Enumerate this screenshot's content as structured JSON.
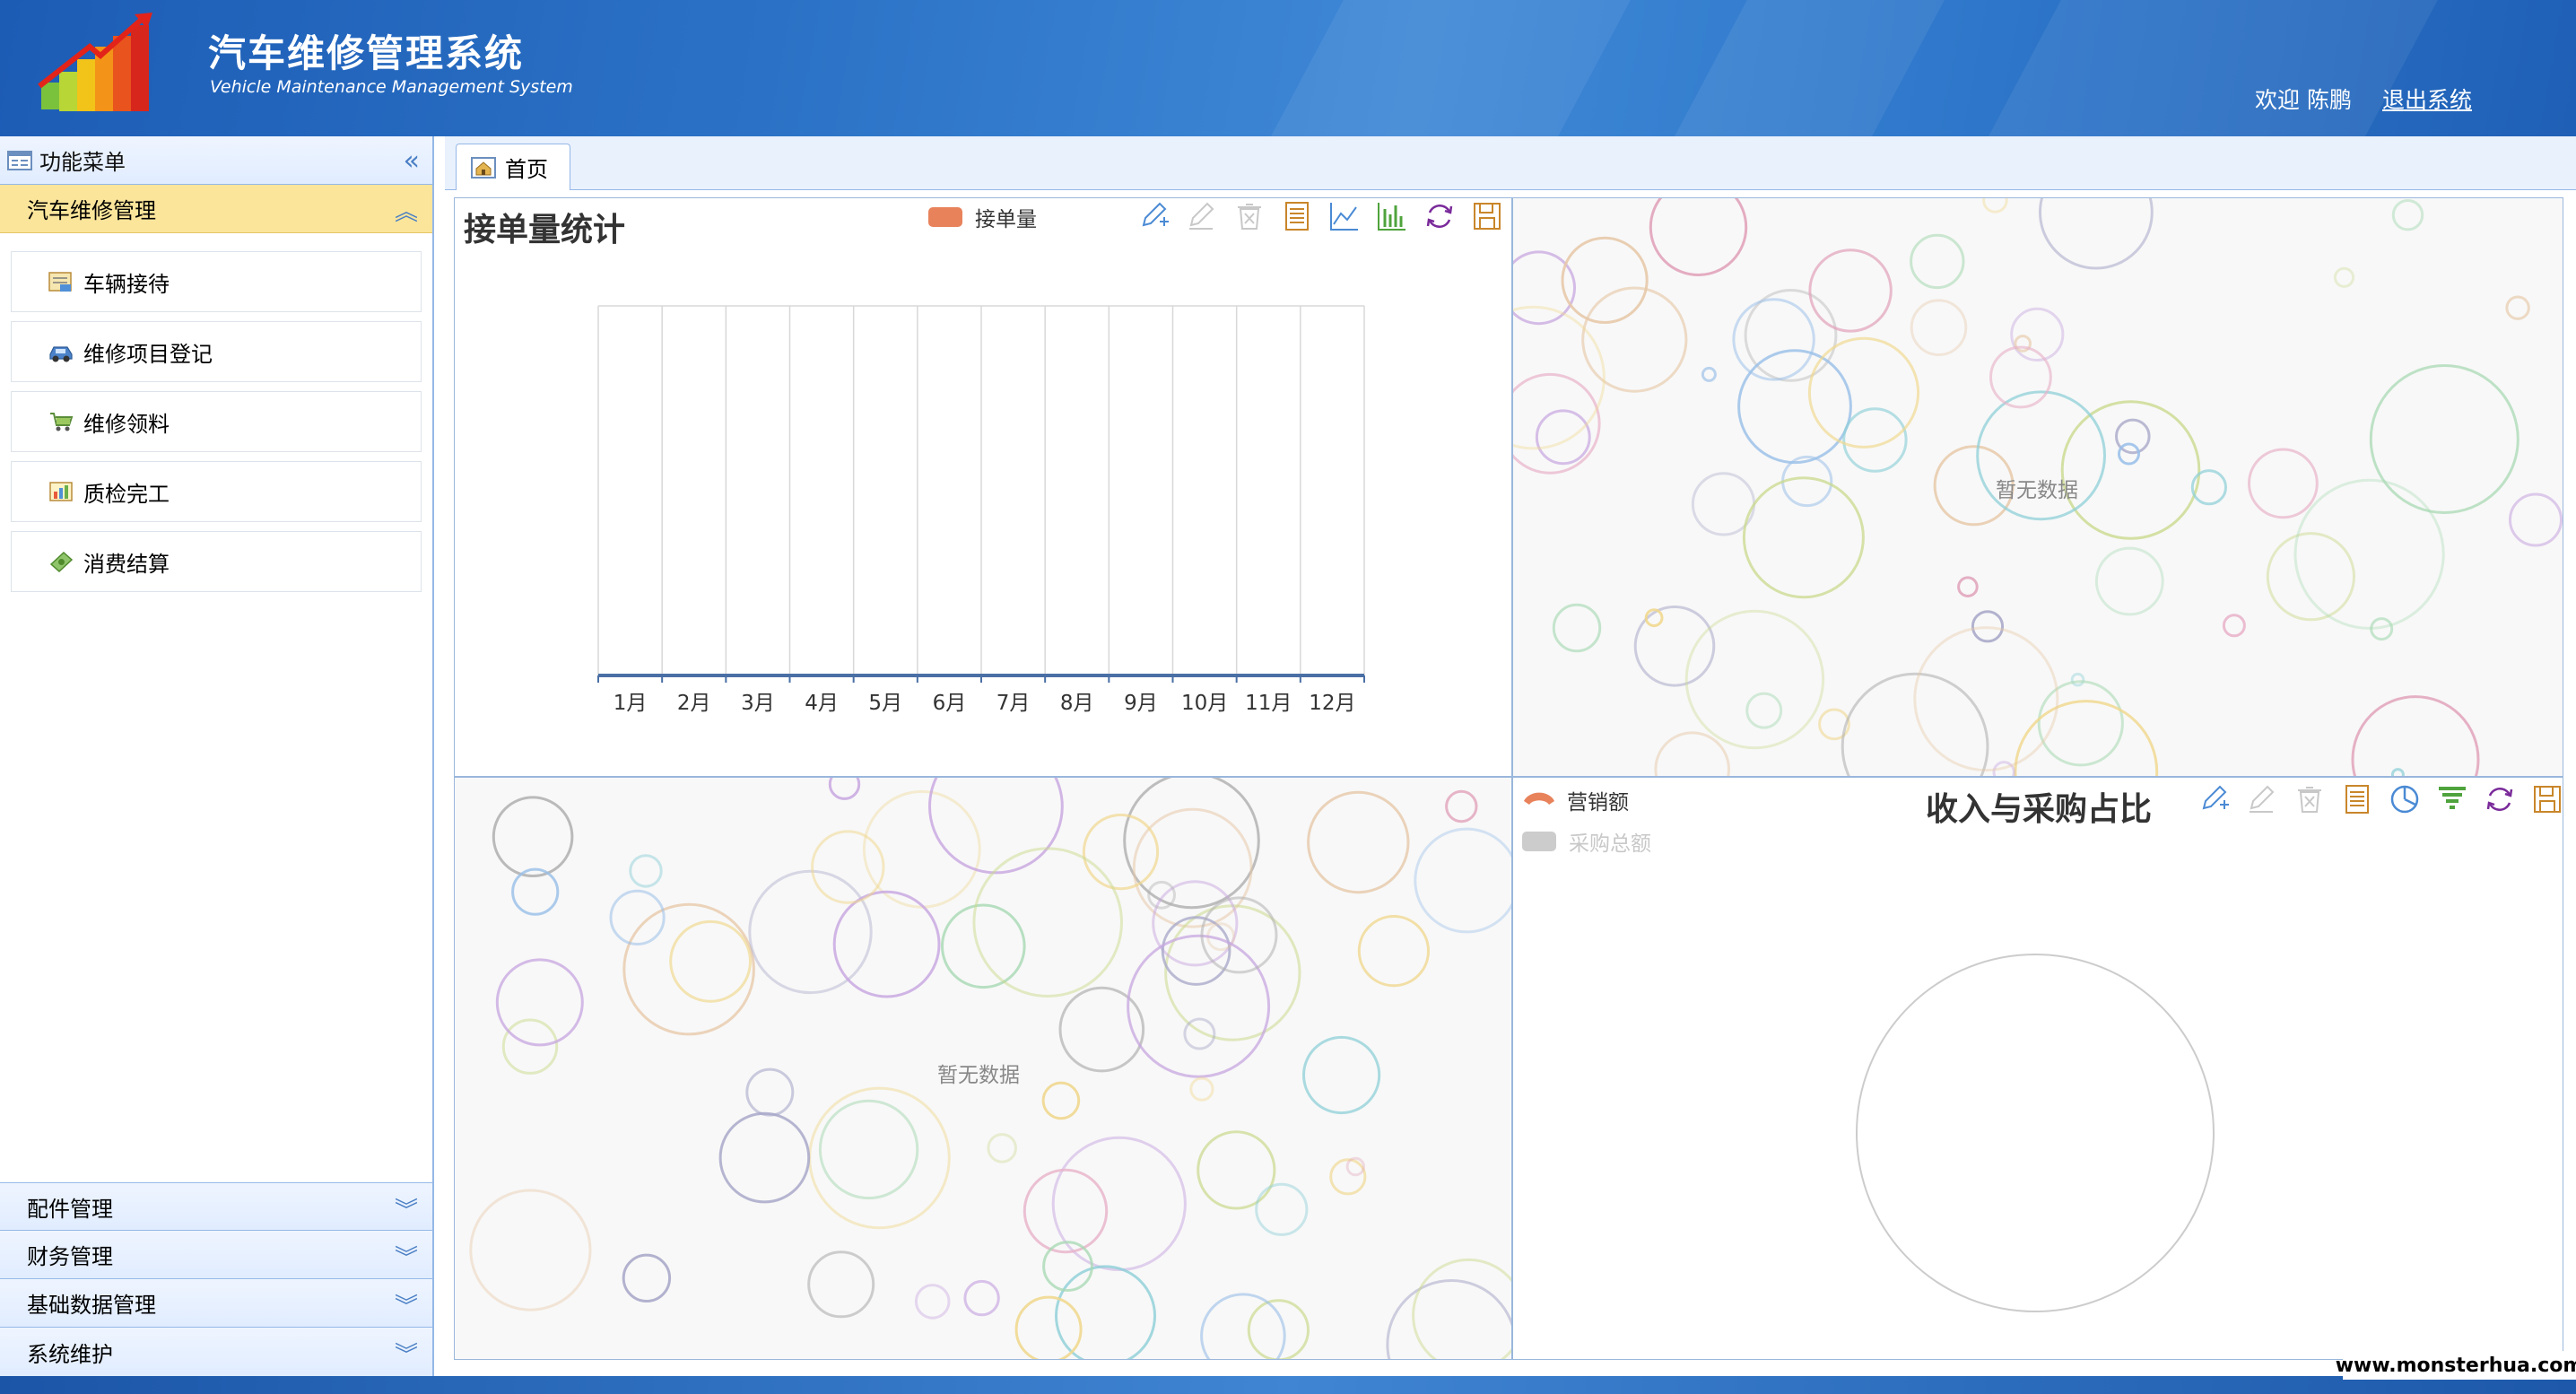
{
  "header": {
    "title": "汽车维修管理系统",
    "subtitle": "Vehicle Maintenance Management System",
    "welcome": "欢迎 陈鹏",
    "logout": "退出系统"
  },
  "sidebar": {
    "title": "功能菜单",
    "groups": [
      {
        "label": "汽车维修管理",
        "expanded": true,
        "items": [
          "车辆接待",
          "维修项目登记",
          "维修领料",
          "质检完工",
          "消费结算"
        ]
      },
      {
        "label": "配件管理",
        "expanded": false
      },
      {
        "label": "财务管理",
        "expanded": false
      },
      {
        "label": "基础数据管理",
        "expanded": false
      },
      {
        "label": "系统维护",
        "expanded": false
      }
    ]
  },
  "tabs": [
    {
      "label": "首页",
      "active": true
    }
  ],
  "panels": {
    "orders": {
      "title": "接单量统计"
    },
    "top_right": {
      "empty_text": "暂无数据"
    },
    "bottom_left": {
      "empty_text": "暂无数据"
    },
    "pie": {
      "title": "收入与采购占比"
    }
  },
  "toolbox_orders": [
    "edit-icon",
    "eraser-icon",
    "trash-icon",
    "data-view-icon",
    "line-chart-icon",
    "bar-chart-icon",
    "refresh-icon",
    "save-icon"
  ],
  "toolbox_pie": [
    "edit-icon",
    "eraser-icon",
    "trash-icon",
    "data-view-icon",
    "pie-chart-icon",
    "funnel-icon",
    "refresh-icon",
    "save-icon"
  ],
  "colors": {
    "series_orders": "#e8825b",
    "sales": "#e8825b",
    "purchase_inactive": "#cccccc",
    "header_blue": "#2b72c6",
    "accordion_open": "#fbe59b"
  },
  "chart_data": [
    {
      "type": "bar",
      "title": "接单量统计",
      "categories": [
        "1月",
        "2月",
        "3月",
        "4月",
        "5月",
        "6月",
        "7月",
        "8月",
        "9月",
        "10月",
        "11月",
        "12月"
      ],
      "series": [
        {
          "name": "接单量",
          "values": [
            0,
            0,
            0,
            0,
            0,
            0,
            0,
            0,
            0,
            0,
            0,
            0
          ]
        }
      ],
      "grid": true
    },
    {
      "type": "pie",
      "title": "收入与采购占比",
      "series": [
        {
          "name": "营销额",
          "value": 0,
          "active": true
        },
        {
          "name": "采购总额",
          "value": 0,
          "active": false
        }
      ]
    }
  ],
  "footer": {
    "watermark": "www.monsterhua.com"
  }
}
